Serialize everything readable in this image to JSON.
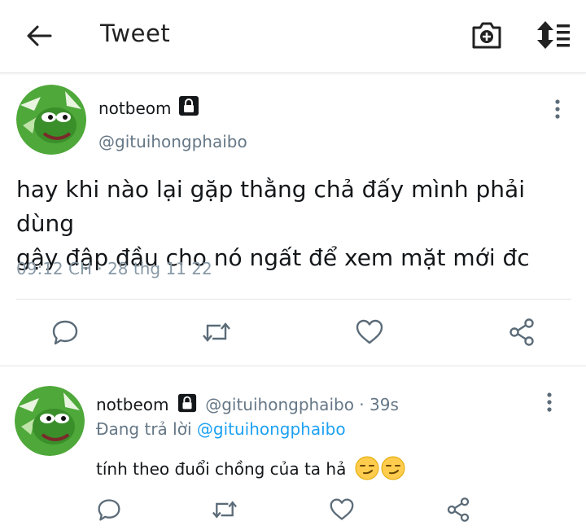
{
  "header": {
    "title": "Tweet",
    "back_icon": "arrow-left-icon",
    "camera_icon": "camera-plus-icon",
    "sort_icon": "sort-icon"
  },
  "tweet": {
    "name": "notbeom",
    "handle": "@gituihongphaibo",
    "text_line1": "hay khi nào lại gặp thằng chả đấy mình phải dùng",
    "text_line2": "gậy đập đầu cho nó ngất để xem mặt mới đc",
    "time": "09:12 CH",
    "date": "28 thg 11 22",
    "dot": "·"
  },
  "reply": {
    "name": "notbeom",
    "handle": "@gituihongphaibo",
    "dot": "·",
    "age": "39s",
    "replying_label": "Đang trả lời",
    "replying_to": "@gituihongphaibo",
    "text": "tính theo đuổi chồng của ta hả",
    "emoji_count": 2
  },
  "colors": {
    "accent": "#1da1f2",
    "muted": "#657786",
    "divider": "#e1e5e8",
    "avatar_green": "#3e9b2c"
  }
}
